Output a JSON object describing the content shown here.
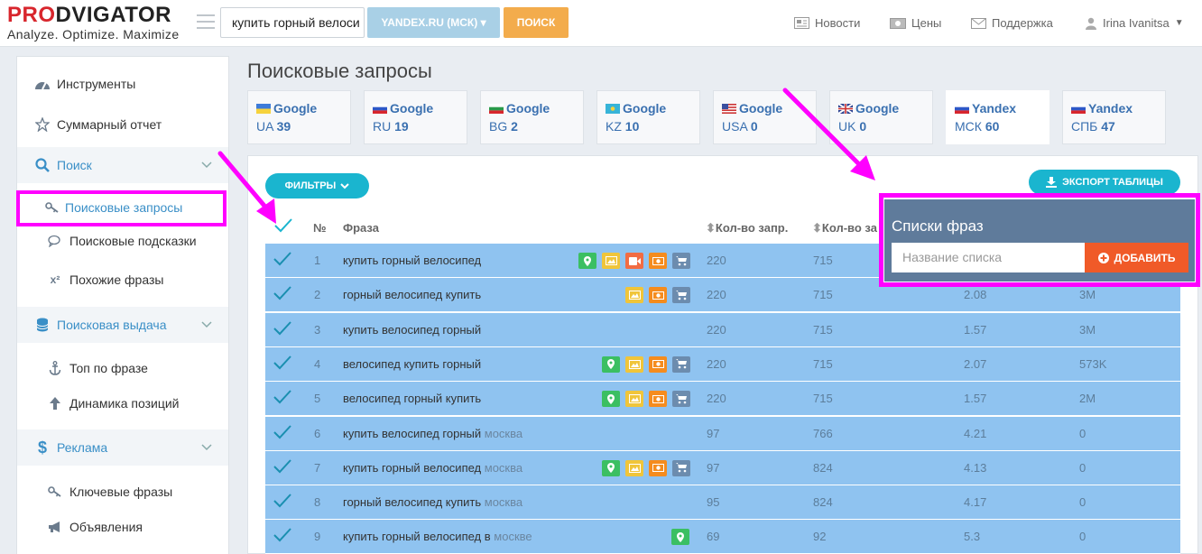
{
  "logo": {
    "main_red": "PRO",
    "main_dark": "DVIGATOR",
    "tagline": "Analyze. Optimize. Maximize"
  },
  "header": {
    "search_value": "купить горный велоси",
    "engine_label": "YANDEX.RU (МСК)",
    "search_button": "ПОИСК",
    "nav": {
      "news": "Новости",
      "prices": "Цены",
      "support": "Поддержка",
      "user": "Irina Ivanitsa"
    }
  },
  "sidebar": {
    "tools": "Инструменты",
    "summary": "Суммарный отчет",
    "search_group": "Поиск",
    "search_queries": "Поисковые запросы",
    "search_hints": "Поисковые подсказки",
    "similar": "Похожие фразы",
    "serp_group": "Поисковая выдача",
    "top_by_phrase": "Топ по фразе",
    "position_dynamics": "Динамика позиций",
    "ads_group": "Реклама",
    "keywords": "Ключевые фразы",
    "ads": "Объявления"
  },
  "page": {
    "title": "Поисковые запросы"
  },
  "engines": [
    {
      "name": "Google",
      "region": "UA",
      "count": "39",
      "flag": "ua"
    },
    {
      "name": "Google",
      "region": "RU",
      "count": "19",
      "flag": "ru"
    },
    {
      "name": "Google",
      "region": "BG",
      "count": "2",
      "flag": "bg"
    },
    {
      "name": "Google",
      "region": "KZ",
      "count": "10",
      "flag": "kz"
    },
    {
      "name": "Google",
      "region": "USA",
      "count": "0",
      "flag": "us"
    },
    {
      "name": "Google",
      "region": "UK",
      "count": "0",
      "flag": "uk"
    },
    {
      "name": "Yandex",
      "region": "МСК",
      "count": "60",
      "flag": "ru"
    },
    {
      "name": "Yandex",
      "region": "СПБ",
      "count": "47",
      "flag": "ru"
    }
  ],
  "toolbar": {
    "filters": "ФИЛЬТРЫ",
    "export": "ЭКСПОРТ ТАБЛИЦЫ"
  },
  "table": {
    "headers": {
      "num": "№",
      "phrase": "Фраза",
      "requests": "Кол-во запр.",
      "col4": "Кол-во за"
    },
    "rows": [
      {
        "n": "1",
        "phrase": "купить горный велосипед",
        "geo": "",
        "req": "220",
        "c4": "715",
        "c5": "",
        "c6": ""
      },
      {
        "n": "2",
        "phrase": "горный велосипед купить",
        "geo": "",
        "req": "220",
        "c4": "715",
        "c5": "2.08",
        "c6": "3M"
      },
      {
        "n": "3",
        "phrase": "купить велосипед горный",
        "geo": "",
        "req": "220",
        "c4": "715",
        "c5": "1.57",
        "c6": "3M"
      },
      {
        "n": "4",
        "phrase": "велосипед купить горный",
        "geo": "",
        "req": "220",
        "c4": "715",
        "c5": "2.07",
        "c6": "573K"
      },
      {
        "n": "5",
        "phrase": "велосипед горный купить",
        "geo": "",
        "req": "220",
        "c4": "715",
        "c5": "1.57",
        "c6": "2M"
      },
      {
        "n": "6",
        "phrase": "купить велосипед горный",
        "geo": "москва",
        "req": "97",
        "c4": "766",
        "c5": "4.21",
        "c6": "0"
      },
      {
        "n": "7",
        "phrase": "купить горный велосипед",
        "geo": "москва",
        "req": "97",
        "c4": "824",
        "c5": "4.13",
        "c6": "0"
      },
      {
        "n": "8",
        "phrase": "горный велосипед купить",
        "geo": "москва",
        "req": "95",
        "c4": "824",
        "c5": "4.17",
        "c6": "0"
      },
      {
        "n": "9",
        "phrase": "купить горный велосипед в",
        "geo": "москве",
        "req": "69",
        "c4": "92",
        "c5": "5.3",
        "c6": "0"
      }
    ]
  },
  "popup": {
    "title": "Списки фраз",
    "placeholder": "Название списка",
    "add": "ДОБАВИТЬ"
  },
  "colors": {
    "accent": "#1ab5cf",
    "highlight": "#ff00ff",
    "row": "#8fc3f0",
    "orange": "#f3ac4c",
    "brand_red": "#d8262d"
  }
}
